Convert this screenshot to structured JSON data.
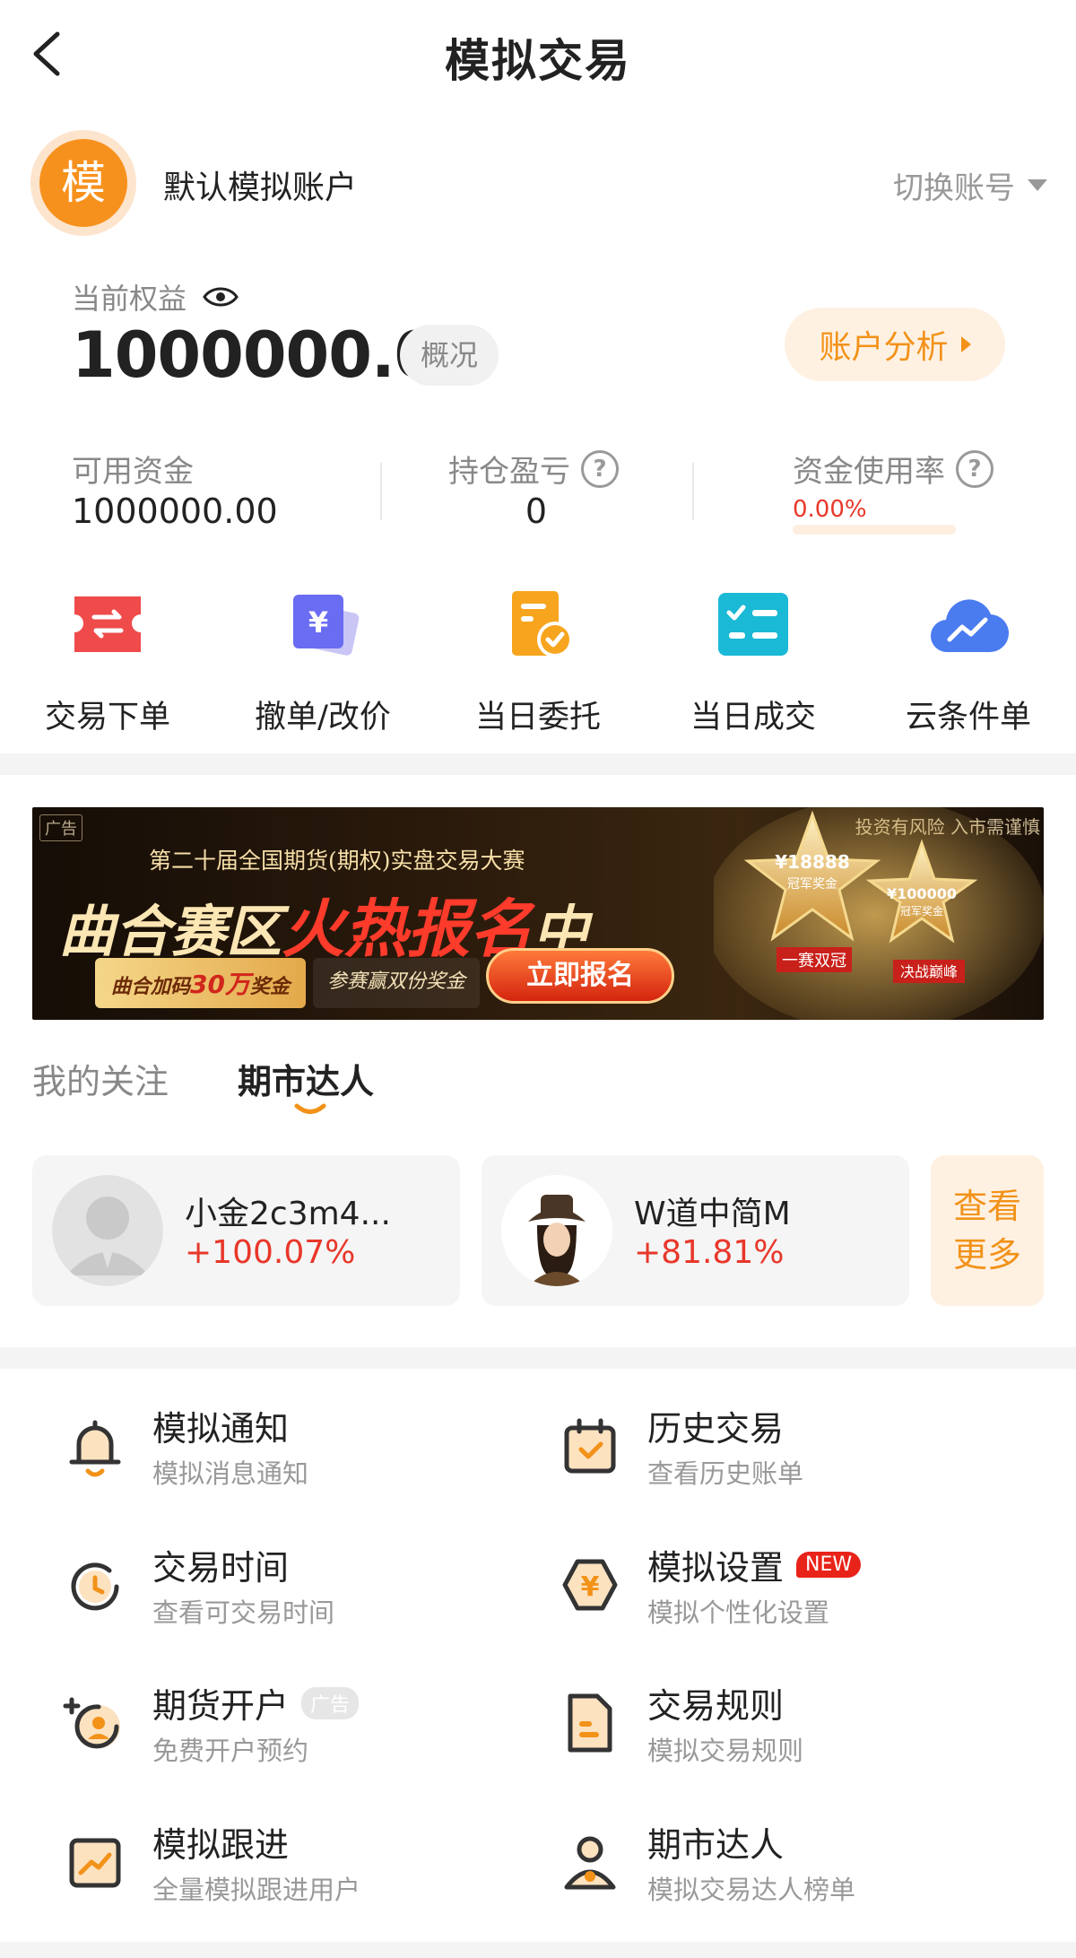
{
  "header": {
    "title": "模拟交易"
  },
  "account": {
    "avatar_char": "模",
    "name": "默认模拟账户",
    "switch_label": "切换账号"
  },
  "equity": {
    "label": "当前权益",
    "value": "1000000.00",
    "overview_label": "概况",
    "analysis_label": "账户分析"
  },
  "stats": {
    "available": {
      "label": "可用资金",
      "value": "1000000.00"
    },
    "position_pnl": {
      "label": "持仓盈亏",
      "value": "0"
    },
    "usage": {
      "label": "资金使用率",
      "value": "0.00%",
      "fraction": 0.0
    }
  },
  "quick_actions": [
    {
      "label": "交易下单",
      "icon": "exchange-ticket-icon",
      "color": "#ee4a4a"
    },
    {
      "label": "撤单/改价",
      "icon": "yuan-card-icon",
      "color": "#6a6df2"
    },
    {
      "label": "当日委托",
      "icon": "document-check-icon",
      "color": "#f7a51e"
    },
    {
      "label": "当日成交",
      "icon": "checklist-icon",
      "color": "#1ab9d6"
    },
    {
      "label": "云条件单",
      "icon": "cloud-trend-icon",
      "color": "#4a7cf0"
    }
  ],
  "banner": {
    "ad_tag": "广告",
    "risk_text": "投资有风险 入市需谨慎",
    "competition": "第二十届全国期货(期权)实盘交易大赛",
    "main_prefix": "曲合赛区",
    "main_hot": "火热报名",
    "main_suffix": "中",
    "sub_a_prefix": "曲合加码",
    "sub_a_amount": "30万",
    "sub_a_suffix": "奖金",
    "sub_b": "参赛赢双份奖金",
    "button": "立即报名",
    "prize1": "¥18888",
    "prize1_label": "冠军奖金",
    "prize2": "¥100000",
    "prize2_label": "冠军奖金",
    "ribbon1": "一赛双冠",
    "ribbon2": "决战巅峰"
  },
  "tabs": [
    {
      "label": "我的关注",
      "active": false
    },
    {
      "label": "期市达人",
      "active": true
    }
  ],
  "experts": [
    {
      "name": "小金2c3m4...",
      "return": "+100.07%"
    },
    {
      "name": "W道中简M",
      "return": "+81.81%"
    }
  ],
  "more_label_1": "查看",
  "more_label_2": "更多",
  "menu": [
    {
      "title": "模拟通知",
      "subtitle": "模拟消息通知",
      "icon": "bell-icon"
    },
    {
      "title": "历史交易",
      "subtitle": "查看历史账单",
      "icon": "calendar-check-icon"
    },
    {
      "title": "交易时间",
      "subtitle": "查看可交易时间",
      "icon": "clock-refresh-icon"
    },
    {
      "title": "模拟设置",
      "subtitle": "模拟个性化设置",
      "icon": "yuan-hexagon-icon",
      "badge": "NEW"
    },
    {
      "title": "期货开户",
      "subtitle": "免费开户预约",
      "icon": "add-user-icon",
      "badge": "广告"
    },
    {
      "title": "交易规则",
      "subtitle": "模拟交易规则",
      "icon": "rules-document-icon"
    },
    {
      "title": "模拟跟进",
      "subtitle": "全量模拟跟进用户",
      "icon": "trend-chart-icon"
    },
    {
      "title": "期市达人",
      "subtitle": "模拟交易达人榜单",
      "icon": "expert-user-icon"
    }
  ],
  "colors": {
    "accent": "#f29219",
    "up": "#e8372a",
    "avatar": "#f7911d"
  }
}
